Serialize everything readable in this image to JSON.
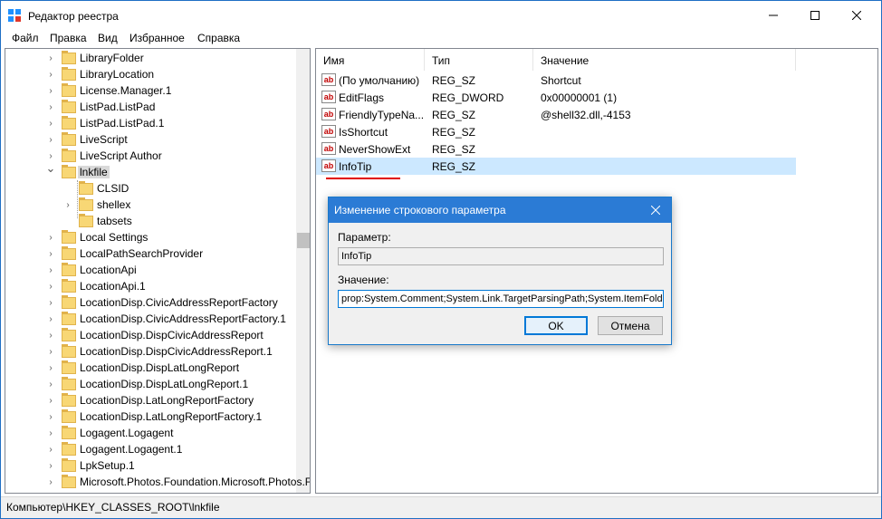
{
  "window": {
    "title": "Редактор реестра"
  },
  "menu": [
    "Файл",
    "Правка",
    "Вид",
    "Избранное",
    "Справка"
  ],
  "tree": {
    "items": [
      {
        "label": "LibraryFolder",
        "level": 1,
        "expander": "collapsed"
      },
      {
        "label": "LibraryLocation",
        "level": 1,
        "expander": "collapsed"
      },
      {
        "label": "License.Manager.1",
        "level": 1,
        "expander": "collapsed"
      },
      {
        "label": "ListPad.ListPad",
        "level": 1,
        "expander": "collapsed"
      },
      {
        "label": "ListPad.ListPad.1",
        "level": 1,
        "expander": "collapsed"
      },
      {
        "label": "LiveScript",
        "level": 1,
        "expander": "collapsed"
      },
      {
        "label": "LiveScript Author",
        "level": 1,
        "expander": "collapsed"
      },
      {
        "label": "lnkfile",
        "level": 1,
        "expander": "expanded",
        "selected": true
      },
      {
        "label": "CLSID",
        "level": 2,
        "expander": "none"
      },
      {
        "label": "shellex",
        "level": 2,
        "expander": "collapsed"
      },
      {
        "label": "tabsets",
        "level": 2,
        "expander": "none"
      },
      {
        "label": "Local Settings",
        "level": 1,
        "expander": "collapsed"
      },
      {
        "label": "LocalPathSearchProvider",
        "level": 1,
        "expander": "collapsed"
      },
      {
        "label": "LocationApi",
        "level": 1,
        "expander": "collapsed"
      },
      {
        "label": "LocationApi.1",
        "level": 1,
        "expander": "collapsed"
      },
      {
        "label": "LocationDisp.CivicAddressReportFactory",
        "level": 1,
        "expander": "collapsed"
      },
      {
        "label": "LocationDisp.CivicAddressReportFactory.1",
        "level": 1,
        "expander": "collapsed"
      },
      {
        "label": "LocationDisp.DispCivicAddressReport",
        "level": 1,
        "expander": "collapsed"
      },
      {
        "label": "LocationDisp.DispCivicAddressReport.1",
        "level": 1,
        "expander": "collapsed"
      },
      {
        "label": "LocationDisp.DispLatLongReport",
        "level": 1,
        "expander": "collapsed"
      },
      {
        "label": "LocationDisp.DispLatLongReport.1",
        "level": 1,
        "expander": "collapsed"
      },
      {
        "label": "LocationDisp.LatLongReportFactory",
        "level": 1,
        "expander": "collapsed"
      },
      {
        "label": "LocationDisp.LatLongReportFactory.1",
        "level": 1,
        "expander": "collapsed"
      },
      {
        "label": "Logagent.Logagent",
        "level": 1,
        "expander": "collapsed"
      },
      {
        "label": "Logagent.Logagent.1",
        "level": 1,
        "expander": "collapsed"
      },
      {
        "label": "LpkSetup.1",
        "level": 1,
        "expander": "collapsed"
      },
      {
        "label": "Microsoft.Photos.Foundation.Microsoft.Photos.Foundation",
        "level": 1,
        "expander": "collapsed"
      }
    ]
  },
  "values": {
    "columns": [
      "Имя",
      "Тип",
      "Значение"
    ],
    "rows": [
      {
        "name": "(По умолчанию)",
        "type": "REG_SZ",
        "data": "Shortcut"
      },
      {
        "name": "EditFlags",
        "type": "REG_DWORD",
        "data": "0x00000001 (1)"
      },
      {
        "name": "FriendlyTypeNa...",
        "type": "REG_SZ",
        "data": "@shell32.dll,-4153"
      },
      {
        "name": "IsShortcut",
        "type": "REG_SZ",
        "data": ""
      },
      {
        "name": "NeverShowExt",
        "type": "REG_SZ",
        "data": ""
      },
      {
        "name": "InfoTip",
        "type": "REG_SZ",
        "data": "",
        "selected": true
      }
    ]
  },
  "status": {
    "path": "Компьютер\\HKEY_CLASSES_ROOT\\lnkfile"
  },
  "dialog": {
    "title": "Изменение строкового параметра",
    "param_label": "Параметр:",
    "param_value": "InfoTip",
    "value_label": "Значение:",
    "value_value": "prop:System.Comment;System.Link.TargetParsingPath;System.ItemFolderPa",
    "ok": "OK",
    "cancel": "Отмена"
  },
  "colors": {
    "accent": "#2b7bd5",
    "selection": "#cce8ff",
    "folder": "#f8d775",
    "underline": "#e00000"
  }
}
